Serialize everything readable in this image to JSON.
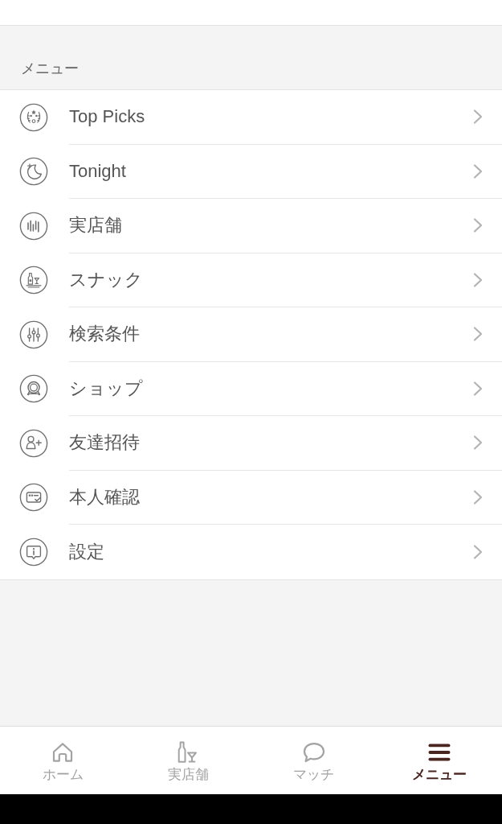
{
  "section_title": "メニュー",
  "menu_items": [
    {
      "kind": "laurel",
      "label": "Top Picks"
    },
    {
      "kind": "moon",
      "label": "Tonight"
    },
    {
      "kind": "bars",
      "label": "実店舗"
    },
    {
      "kind": "bottle",
      "label": "スナック"
    },
    {
      "kind": "sliders",
      "label": "検索条件"
    },
    {
      "kind": "medal",
      "label": "ショップ"
    },
    {
      "kind": "person",
      "label": "友達招待"
    },
    {
      "kind": "card",
      "label": "本人確認"
    },
    {
      "kind": "info",
      "label": "設定"
    }
  ],
  "tab_bar": {
    "tabs": [
      {
        "kind": "home",
        "label": "ホーム",
        "selected": false
      },
      {
        "kind": "bottle",
        "label": "実店舗",
        "selected": false
      },
      {
        "kind": "chat",
        "label": "マッチ",
        "selected": false
      },
      {
        "kind": "menu",
        "label": "メニュー",
        "selected": true
      }
    ]
  }
}
